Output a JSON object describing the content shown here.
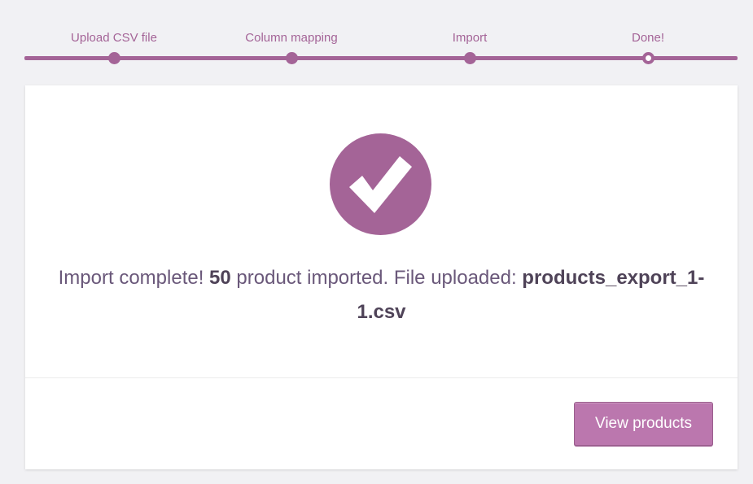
{
  "steps": [
    {
      "label": "Upload CSV file",
      "state": "done"
    },
    {
      "label": "Column mapping",
      "state": "done"
    },
    {
      "label": "Import",
      "state": "done"
    },
    {
      "label": "Done!",
      "state": "current"
    }
  ],
  "result": {
    "icon": "checkmark-icon",
    "text_before_count": "Import complete! ",
    "count": "50",
    "text_after_count": " product imported. File uploaded: ",
    "filename": "products_export_1-1.csv"
  },
  "actions": {
    "view_products_label": "View products"
  },
  "colors": {
    "accent": "#a46497",
    "button": "#bb77ae",
    "background": "#f1f1f4",
    "card": "#ffffff"
  }
}
